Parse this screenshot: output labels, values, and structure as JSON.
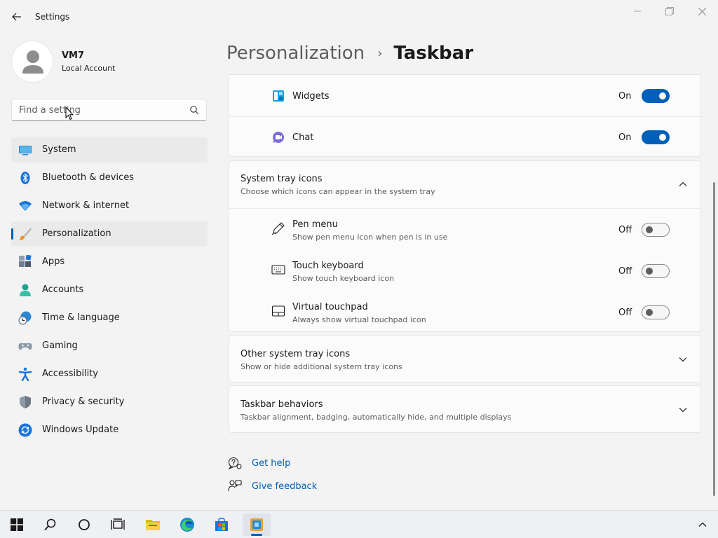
{
  "window": {
    "title": "Settings",
    "controls": [
      "minimize-icon",
      "maximize-icon",
      "close-icon"
    ]
  },
  "profile": {
    "name": "VM7",
    "account_type": "Local Account"
  },
  "search": {
    "placeholder": "Find a setting",
    "icon": "search-icon"
  },
  "sidebar": {
    "items": [
      {
        "label": "System",
        "icon": "system-icon"
      },
      {
        "label": "Bluetooth & devices",
        "icon": "bluetooth-icon"
      },
      {
        "label": "Network & internet",
        "icon": "wifi-icon"
      },
      {
        "label": "Personalization",
        "icon": "brush-icon",
        "selected": true
      },
      {
        "label": "Apps",
        "icon": "apps-icon"
      },
      {
        "label": "Accounts",
        "icon": "accounts-icon"
      },
      {
        "label": "Time & language",
        "icon": "clock-globe-icon"
      },
      {
        "label": "Gaming",
        "icon": "gamepad-icon"
      },
      {
        "label": "Accessibility",
        "icon": "accessibility-icon"
      },
      {
        "label": "Privacy & security",
        "icon": "shield-icon"
      },
      {
        "label": "Windows Update",
        "icon": "update-icon"
      }
    ]
  },
  "breadcrumb": {
    "parent": "Personalization",
    "separator": "›",
    "current": "Taskbar"
  },
  "taskbar_items_card": {
    "rows": [
      {
        "title": "Widgets",
        "state": "On",
        "on": true,
        "icon": "widgets-icon"
      },
      {
        "title": "Chat",
        "state": "On",
        "on": true,
        "icon": "chat-icon"
      }
    ]
  },
  "system_tray": {
    "title": "System tray icons",
    "subtitle": "Choose which icons can appear in the system tray",
    "expanded": true,
    "rows": [
      {
        "title": "Pen menu",
        "subtitle": "Show pen menu icon when pen is in use",
        "state": "Off",
        "on": false,
        "icon": "pen-icon"
      },
      {
        "title": "Touch keyboard",
        "subtitle": "Show touch keyboard icon",
        "state": "Off",
        "on": false,
        "icon": "keyboard-icon"
      },
      {
        "title": "Virtual touchpad",
        "subtitle": "Always show virtual touchpad icon",
        "state": "Off",
        "on": false,
        "icon": "touchpad-icon"
      }
    ]
  },
  "other_tray": {
    "title": "Other system tray icons",
    "subtitle": "Show or hide additional system tray icons"
  },
  "behaviors": {
    "title": "Taskbar behaviors",
    "subtitle": "Taskbar alignment, badging, automatically hide, and multiple displays"
  },
  "links": {
    "help": "Get help",
    "feedback": "Give feedback"
  },
  "colors": {
    "accent": "#005fb8",
    "background": "#f3f3f3",
    "card": "#fbfbfb"
  },
  "os_taskbar": {
    "items": [
      "start-icon",
      "search-icon",
      "cortana-icon",
      "task-view-icon",
      "file-explorer-icon",
      "edge-icon",
      "store-icon",
      "settings-app-icon"
    ],
    "active": "settings-app-icon",
    "tray": [
      "chevron-up-icon"
    ]
  }
}
